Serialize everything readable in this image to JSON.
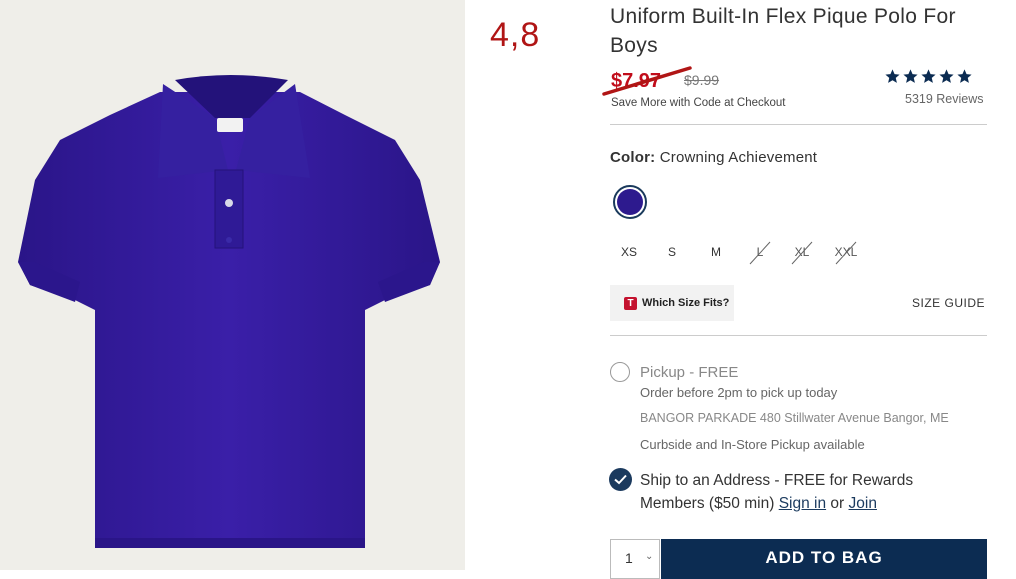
{
  "annotation": "4,8",
  "product": {
    "title": "Uniform Built-In Flex Pique Polo For Boys",
    "sale_price": "$7.97",
    "original_price": "$9.99",
    "promo": "Save More with Code at Checkout",
    "rating_stars": 5,
    "reviews": "5319 Reviews"
  },
  "color": {
    "label": "Color:",
    "value": "Crowning Achievement",
    "swatch_hex": "#2d1a8e"
  },
  "sizes": [
    {
      "label": "XS",
      "available": true
    },
    {
      "label": "S",
      "available": true
    },
    {
      "label": "M",
      "available": true
    },
    {
      "label": "L",
      "available": false
    },
    {
      "label": "XL",
      "available": false
    },
    {
      "label": "XXL",
      "available": false
    }
  ],
  "fit": {
    "label": "Which Size Fits?",
    "logo": "T"
  },
  "size_guide": "SIZE GUIDE",
  "pickup": {
    "title": "Pickup - FREE",
    "order_before": "Order before 2pm to pick up today",
    "store": "BANGOR PARKADE 480 Stillwater Avenue Bangor, ME",
    "curbside": "Curbside and In-Store Pickup available"
  },
  "ship": {
    "text": "Ship to an Address - FREE for Rewards Members ($50 min)",
    "sign_in": "Sign in",
    "or": "or",
    "join": "Join"
  },
  "quantity": "1",
  "add_to_bag": "ADD TO BAG",
  "colors": {
    "accent": "#0c2c52",
    "sale": "#c10c1a",
    "annotation": "#b01515"
  }
}
